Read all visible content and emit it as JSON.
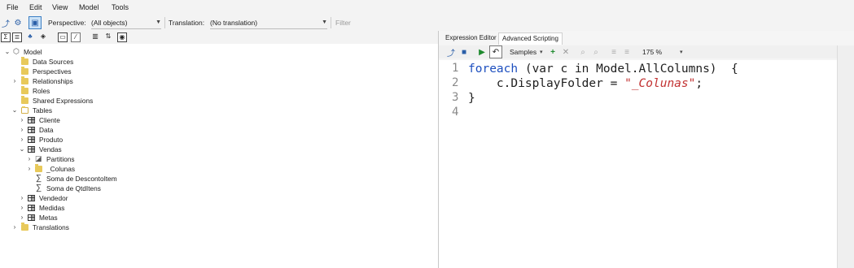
{
  "menu": [
    "File",
    "Edit",
    "View",
    "Model",
    "Tools"
  ],
  "toolbar": {
    "perspective_label": "Perspective:",
    "perspective_value": "(All objects)",
    "translation_label": "Translation:",
    "translation_value": "(No translation)",
    "filter_placeholder": "Filter"
  },
  "tree": {
    "root": "Model",
    "items": [
      "Data Sources",
      "Perspectives",
      "Relationships",
      "Roles",
      "Shared Expressions",
      "Tables",
      "Cliente",
      "Data",
      "Produto",
      "Vendas",
      "Partitions",
      "_Colunas",
      "Soma de DescontoItem",
      "Soma de QtdItens",
      "Vendedor",
      "Medidas",
      "Metas",
      "Translations"
    ]
  },
  "tabs": [
    "Expression Editor",
    "Advanced Scripting"
  ],
  "editor_toolbar": {
    "samples": "Samples",
    "zoom": "175 %"
  },
  "code": {
    "line_numbers": [
      "1",
      "2",
      "3",
      "4"
    ],
    "l1_kw": "foreach",
    "l1_rest": " (var c in Model.AllColumns)  {",
    "l2_pre": "    c.DisplayFolder = ",
    "l2_str": "\"_Colunas\"",
    "l2_post": ";",
    "l3": "}"
  },
  "colors": {
    "keyword": "#1d4fbf",
    "string": "#c23232",
    "folder": "#e8c95a",
    "selection": "#cde3f7"
  }
}
